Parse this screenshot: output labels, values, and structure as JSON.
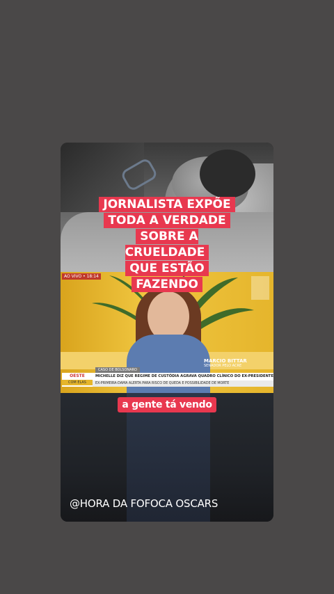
{
  "story": {
    "headline_lines": [
      "JORNALISTA EXPÕE",
      "TODA A VERDADE",
      "SOBRE A CRUELDADE",
      "QUE ESTÃO",
      "FAZENDO"
    ],
    "caption": "a gente tá vendo",
    "handle": "@HORA DA FOFOCA OSCARS"
  },
  "tv": {
    "live_tag": "AO VIVO • 18:14",
    "name": "MARCIO BITTAR",
    "role": "SENADOR PELO ACRE",
    "topic": "CASO DE BOLSONARO",
    "logo_top": "OESTE",
    "logo_bottom": "COM ELAS",
    "main_line": "MICHELLE DIZ QUE REGIME DE CUSTÓDIA AGRAVA QUADRO CLÍNICO DO EX-PRESIDENTE",
    "sub_line": "EX-PRIMEIRA-DAMA ALERTA PARA RISCO DE QUEDA E POSSIBILIDADE DE MORTE"
  },
  "colors": {
    "page_bg": "#4a4848",
    "highlight": "#e8384f",
    "tv_bg": "#e8b92a"
  }
}
